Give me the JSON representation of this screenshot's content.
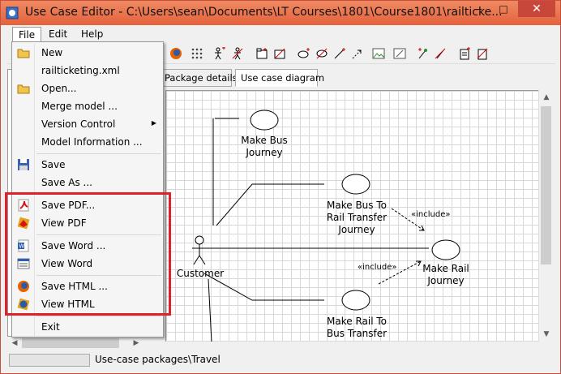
{
  "window": {
    "title": "Use Case Editor - C:\\Users\\sean\\Documents\\LT Courses\\1801\\Course1801\\railticke...",
    "minimize": "‒",
    "maximize": "□",
    "close": "✕"
  },
  "menubar": {
    "items": [
      {
        "label": "File"
      },
      {
        "label": "Edit"
      },
      {
        "label": "Help"
      }
    ]
  },
  "tabs": {
    "package_details": "Package details",
    "use_case_diagram": "Use case diagram",
    "selected": "use_case_diagram"
  },
  "file_menu": {
    "items": [
      {
        "label": "New"
      },
      {
        "label": "railticketing.xml"
      },
      {
        "label": "Open..."
      },
      {
        "label": "Merge model ..."
      },
      {
        "label": "Version Control"
      },
      {
        "label": "Model Information ..."
      },
      {
        "label": "Save"
      },
      {
        "label": "Save As ..."
      },
      {
        "label": "Save PDF..."
      },
      {
        "label": "View PDF"
      },
      {
        "label": "Save Word ..."
      },
      {
        "label": "View Word"
      },
      {
        "label": "Save HTML ..."
      },
      {
        "label": "View HTML"
      },
      {
        "label": "Exit"
      }
    ],
    "submenu_arrow": "▶"
  },
  "diagram": {
    "actor": "Customer",
    "use_cases": [
      {
        "line1": "Make Bus",
        "line2": "Journey"
      },
      {
        "line1": "Make Bus To",
        "line2": "Rail Transfer",
        "line3": "Journey"
      },
      {
        "line1": "Make Rail",
        "line2": "Journey"
      },
      {
        "line1": "Make Rail To",
        "line2": "Bus Transfer"
      }
    ],
    "include_label_1": "«include»",
    "include_label_2": "«include»"
  },
  "scroll": {
    "up": "▲",
    "down": "▼",
    "left": "◀",
    "right": "▶"
  },
  "statusbar": {
    "text": "Use-case packages\\Travel"
  },
  "colors": {
    "titlebar": "#e9734f",
    "close_button": "#c7483a",
    "highlight": "#e0202a"
  }
}
